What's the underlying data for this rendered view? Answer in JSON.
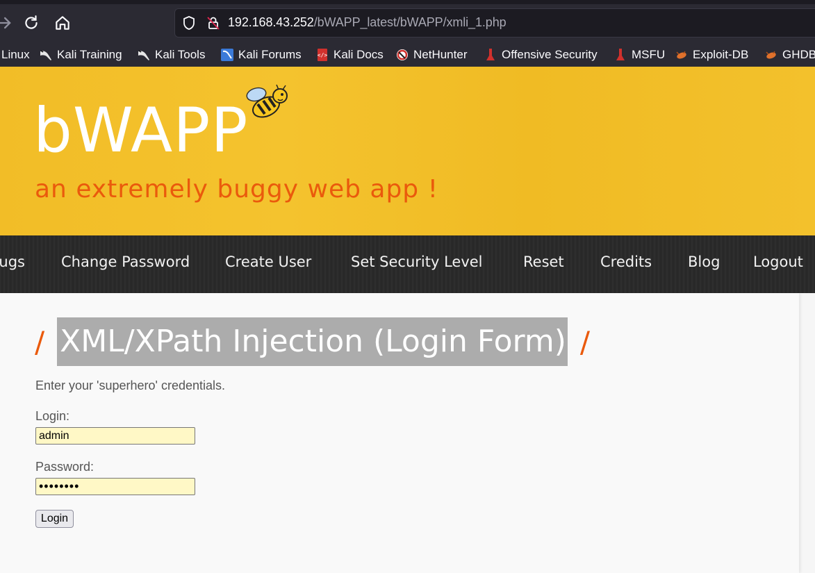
{
  "browser": {
    "url_host": "192.168.43.252",
    "url_path": "/bWAPP_latest/bWAPP/xmli_1.php",
    "bookmarks": [
      {
        "label": "Linux",
        "icon": "kali-icon"
      },
      {
        "label": "Kali Training",
        "icon": "kali-icon"
      },
      {
        "label": "Kali Tools",
        "icon": "kali-icon"
      },
      {
        "label": "Kali Forums",
        "icon": "forums-icon"
      },
      {
        "label": "Kali Docs",
        "icon": "docs-icon"
      },
      {
        "label": "NetHunter",
        "icon": "nethunter-icon"
      },
      {
        "label": "Offensive Security",
        "icon": "offsec-icon"
      },
      {
        "label": "MSFU",
        "icon": "offsec-icon"
      },
      {
        "label": "Exploit-DB",
        "icon": "exploitdb-icon"
      },
      {
        "label": "GHDB",
        "icon": "exploitdb-icon"
      }
    ]
  },
  "header": {
    "logo": "bWAPP",
    "tagline": "an extremely buggy web app !"
  },
  "menu": {
    "items": [
      "Bugs",
      "Change Password",
      "Create User",
      "Set Security Level",
      "Reset",
      "Credits",
      "Blog",
      "Logout"
    ]
  },
  "main": {
    "title_slash": "/",
    "title": "XML/XPath Injection (Login Form)",
    "instructions": "Enter your 'superhero' credentials.",
    "login_label": "Login:",
    "login_value": "admin",
    "password_label": "Password:",
    "password_value": "passwor1",
    "submit_label": "Login"
  },
  "colors": {
    "header_yellow": "#f2bd27",
    "accent_orange": "#ea5a0c",
    "menu_dark": "#2d2d2d",
    "field_yellow": "#fff8c6",
    "title_highlight": "#acacac"
  }
}
